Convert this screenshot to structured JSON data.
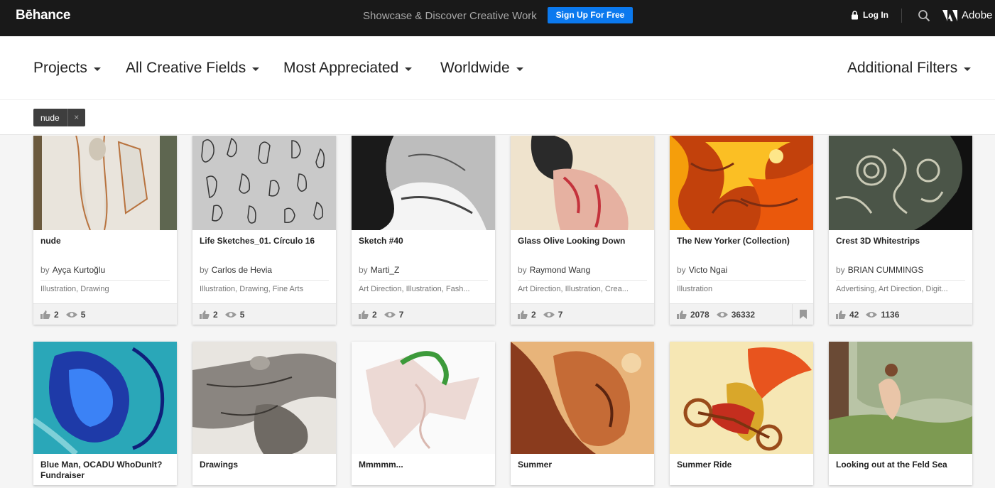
{
  "header": {
    "logo": "Bēhance",
    "tagline": "Showcase & Discover Creative Work",
    "signup_label": "Sign Up For Free",
    "login_label": "Log In",
    "adobe_label": "Adobe"
  },
  "filters": {
    "projects": "Projects",
    "fields": "All Creative Fields",
    "sort": "Most Appreciated",
    "location": "Worldwide",
    "additional": "Additional Filters"
  },
  "active_tag": {
    "label": "nude",
    "remove": "×"
  },
  "projects": [
    {
      "title": "nude",
      "by": "by",
      "owner": "Ayça Kurtoğlu",
      "fields": "Illustration, Drawing",
      "appreciations": "2",
      "views": "5"
    },
    {
      "title": "Life Sketches_01. Círculo 16",
      "by": "by",
      "owner": "Carlos de Hevia",
      "fields": "Illustration, Drawing, Fine Arts",
      "appreciations": "2",
      "views": "5"
    },
    {
      "title": "Sketch #40",
      "by": "by",
      "owner": "Marti_Z",
      "fields": "Art Direction, Illustration, Fash...",
      "appreciations": "2",
      "views": "7"
    },
    {
      "title": "Glass Olive Looking Down",
      "by": "by",
      "owner": "Raymond Wang",
      "fields": "Art Direction, Illustration, Crea...",
      "appreciations": "2",
      "views": "7"
    },
    {
      "title": "The New Yorker (Collection)",
      "by": "by",
      "owner": "Victo Ngai",
      "fields": "Illustration",
      "appreciations": "2078",
      "views": "36332"
    },
    {
      "title": "Crest 3D Whitestrips",
      "by": "by",
      "owner": "BRIAN CUMMINGS",
      "fields": "Advertising, Art Direction, Digit...",
      "appreciations": "42",
      "views": "1136"
    },
    {
      "title": "Blue Man, OCADU WhoDunIt? Fundraiser"
    },
    {
      "title": "Drawings"
    },
    {
      "title": "Mmmmm..."
    },
    {
      "title": "Summer"
    },
    {
      "title": "Summer Ride"
    },
    {
      "title": "Looking out at the Feld Sea"
    }
  ],
  "colors": {
    "topbar": "#191919",
    "signup": "#0b79ee",
    "tag": "#3e3e3e"
  },
  "icons": [
    "lock-icon",
    "search-icon",
    "adobe-icon",
    "caret-down-icon",
    "thumbs-up-icon",
    "eye-icon",
    "bookmark-icon"
  ]
}
